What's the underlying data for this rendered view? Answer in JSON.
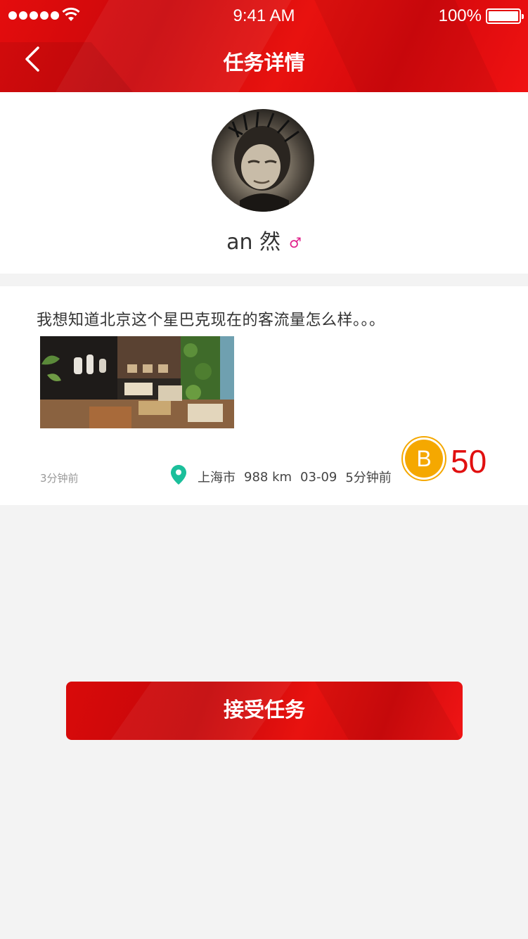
{
  "status_bar": {
    "time": "9:41 AM",
    "battery": "100%",
    "icons": [
      "signal-icon",
      "wifi-icon",
      "battery-icon"
    ]
  },
  "nav": {
    "title": "任务详情",
    "back_icon": "chevron-left-icon"
  },
  "profile": {
    "name": "an 然",
    "gender_symbol": "♂",
    "gender_icon": "male-icon",
    "gender_color": "#e0208a"
  },
  "task": {
    "description": "我想知道北京这个星巴克现在的客流量怎么样。。。",
    "posted_ago": "3分钟前",
    "location": "上海市",
    "distance": "988 km",
    "date": "03-09",
    "updated_ago": "5分钟前",
    "reward_icon": "coin-b-icon",
    "reward": "50"
  },
  "action": {
    "accept_label": "接受任务"
  },
  "colors": {
    "brand_red": "#e40d0d",
    "reward_red": "#e11010",
    "coin_yellow": "#f5a800",
    "pin_teal": "#1bbf9b",
    "background": "#f3f3f3"
  }
}
